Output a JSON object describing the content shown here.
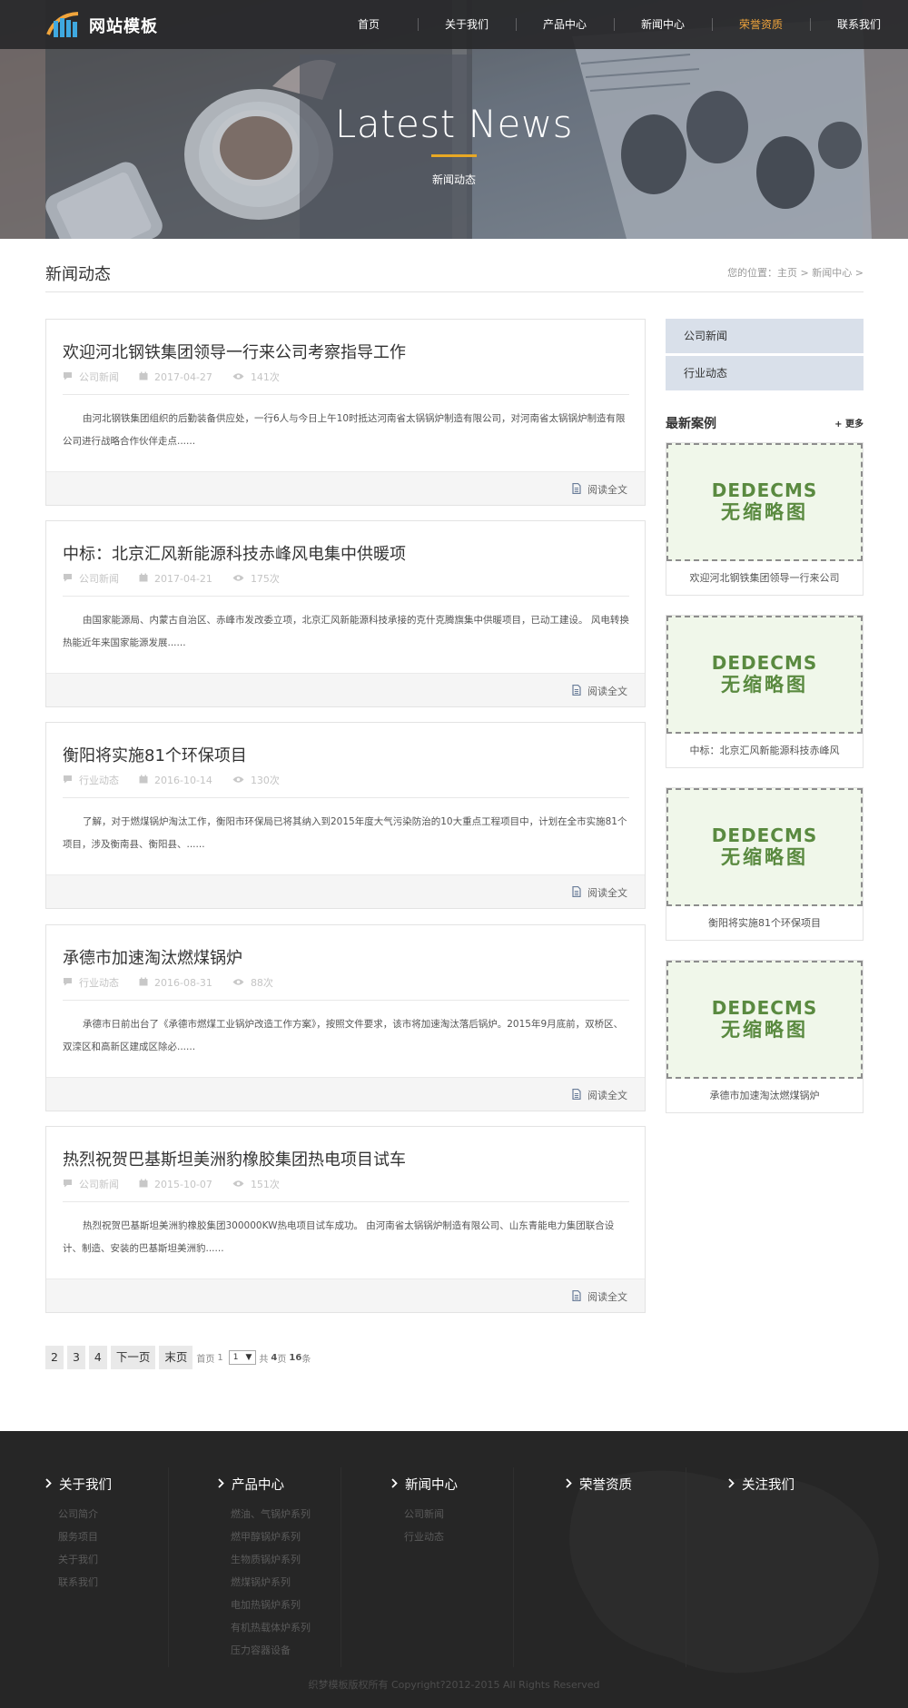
{
  "site": {
    "logo_text": "网站模板",
    "nav": [
      {
        "label": "首页",
        "active": false
      },
      {
        "label": "关于我们",
        "active": false
      },
      {
        "label": "产品中心",
        "active": false
      },
      {
        "label": "新闻中心",
        "active": false
      },
      {
        "label": "荣誉资质",
        "active": true
      },
      {
        "label": "联系我们",
        "active": false
      }
    ]
  },
  "banner": {
    "title": "Latest News",
    "subtitle": "新闻动态"
  },
  "page": {
    "title": "新闻动态",
    "breadcrumb": "您的位置：主页 > 新闻中心 >"
  },
  "articles": [
    {
      "title": "欢迎河北钢铁集团领导一行来公司考察指导工作",
      "category": "公司新闻",
      "date": "2017-04-27",
      "views": "141次",
      "excerpt": "由河北钢铁集团组织的后勤装备供应处，一行6人与今日上午10时抵达河南省太锅锅炉制造有限公司，对河南省太锅锅炉制造有限公司进行战略合作伙伴走点......",
      "read_more": "阅读全文"
    },
    {
      "title": "中标：北京汇风新能源科技赤峰风电集中供暖项",
      "category": "公司新闻",
      "date": "2017-04-21",
      "views": "175次",
      "excerpt": "由国家能源局、内蒙古自治区、赤峰市发改委立项，北京汇风新能源科技承接的克什克腾旗集中供暖项目，已动工建设。 风电转换热能近年来国家能源发展......",
      "read_more": "阅读全文"
    },
    {
      "title": "衡阳将实施81个环保项目",
      "category": "行业动态",
      "date": "2016-10-14",
      "views": "130次",
      "excerpt": "了解，对于燃煤锅炉淘汰工作，衡阳市环保局已将其纳入到2015年度大气污染防治的10大重点工程项目中，计划在全市实施81个项目，涉及衡南县、衡阳县、......",
      "read_more": "阅读全文"
    },
    {
      "title": "承德市加速淘汰燃煤锅炉",
      "category": "行业动态",
      "date": "2016-08-31",
      "views": "88次",
      "excerpt": "承德市日前出台了《承德市燃煤工业锅炉改造工作方案》，按照文件要求，该市将加速淘汰落后锅炉。2015年9月底前，双桥区、双滦区和高新区建成区除必......",
      "read_more": "阅读全文"
    },
    {
      "title": "热烈祝贺巴基斯坦美洲豹橡胶集团热电项目试车",
      "category": "公司新闻",
      "date": "2015-10-07",
      "views": "151次",
      "excerpt": "热烈祝贺巴基斯坦美洲豹橡胶集团300000KW热电项目试车成功。 由河南省太锅锅炉制造有限公司、山东青能电力集团联合设计、制造、安装的巴基斯坦美洲豹......",
      "read_more": "阅读全文"
    }
  ],
  "sidebar": {
    "categories": [
      "公司新闻",
      "行业动态"
    ],
    "cases_title": "最新案例",
    "cases_more": "+ 更多",
    "thumb_line1": "DEDECMS",
    "thumb_line2": "无缩略图",
    "cases": [
      "欢迎河北钢铁集团领导一行来公司",
      "中标：北京汇风新能源科技赤峰风",
      "衡阳将实施81个环保项目",
      "承德市加速淘汰燃煤锅炉"
    ]
  },
  "pagination": {
    "pages": [
      "2",
      "3",
      "4"
    ],
    "next": "下一页",
    "last": "末页",
    "first_label": "首页",
    "current": "1",
    "select_value": "1",
    "total_prefix": "共",
    "total_pages": "4",
    "pages_word": "页",
    "total_items": "16",
    "items_word": "条"
  },
  "footer": {
    "columns": [
      {
        "title": "关于我们",
        "links": [
          "公司简介",
          "服务项目",
          "关于我们",
          "联系我们"
        ]
      },
      {
        "title": "产品中心",
        "links": [
          "燃油、气锅炉系列",
          "燃甲醇锅炉系列",
          "生物质锅炉系列",
          "燃煤锅炉系列",
          "电加热锅炉系列",
          "有机热载体炉系列",
          "压力容器设备"
        ]
      },
      {
        "title": "新闻中心",
        "links": [
          "公司新闻",
          "行业动态"
        ]
      },
      {
        "title": "荣誉资质",
        "links": []
      },
      {
        "title": "关注我们",
        "links": []
      }
    ],
    "copyright": "织梦模板版权所有 Copyright?2012-2015 All Rights Reserved"
  },
  "colors": {
    "accent": "#f1a53c",
    "gold_line": "#e8a824",
    "header_bg": "#28282a",
    "footer_bg": "#262626",
    "side_cat_bg": "#d9e0ea",
    "thumb_text": "#5a8a40"
  },
  "icons": {
    "category": "comment-icon",
    "date": "calendar-icon",
    "views": "eye-icon",
    "read_more": "document-icon",
    "footer_heading": "chevron-right-icon"
  }
}
